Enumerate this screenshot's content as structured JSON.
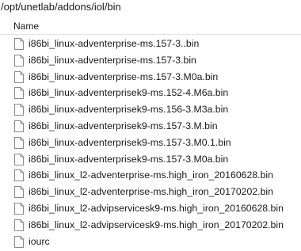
{
  "location": {
    "path": "/opt/unetlab/addons/iol/bin"
  },
  "columns": {
    "name": "Name"
  },
  "files": [
    {
      "name": "i86bi_linux-adventerprise-ms.157-3..bin",
      "icon": "file-icon"
    },
    {
      "name": "i86bi_linux-adventerprise-ms.157-3.bin",
      "icon": "file-icon"
    },
    {
      "name": "i86bi_linux-adventerprise-ms.157-3.M0a.bin",
      "icon": "file-icon"
    },
    {
      "name": "i86bi_linux-adventerprisek9-ms.152-4.M6a.bin",
      "icon": "file-icon"
    },
    {
      "name": "i86bi_linux-adventerprisek9-ms.156-3.M3a.bin",
      "icon": "file-icon"
    },
    {
      "name": "i86bi_linux-adventerprisek9-ms.157-3.M.bin",
      "icon": "file-icon"
    },
    {
      "name": "i86bi_linux-adventerprisek9-ms.157-3.M0.1.bin",
      "icon": "file-icon"
    },
    {
      "name": "i86bi_linux-adventerprisek9-ms.157-3.M0a.bin",
      "icon": "file-icon"
    },
    {
      "name": "i86bi_linux_l2-adventerprise-ms.high_iron_20160628.bin",
      "icon": "file-icon"
    },
    {
      "name": "i86bi_linux_l2-adventerprise-ms.high_iron_20170202.bin",
      "icon": "file-icon"
    },
    {
      "name": "i86bi_linux_l2-advipservicesk9-ms.high_iron_20160628.bin",
      "icon": "file-icon"
    },
    {
      "name": "i86bi_linux_l2-advipservicesk9-ms.high_iron_20170202.bin",
      "icon": "file-icon"
    },
    {
      "name": "iourc",
      "icon": "file-icon"
    }
  ]
}
